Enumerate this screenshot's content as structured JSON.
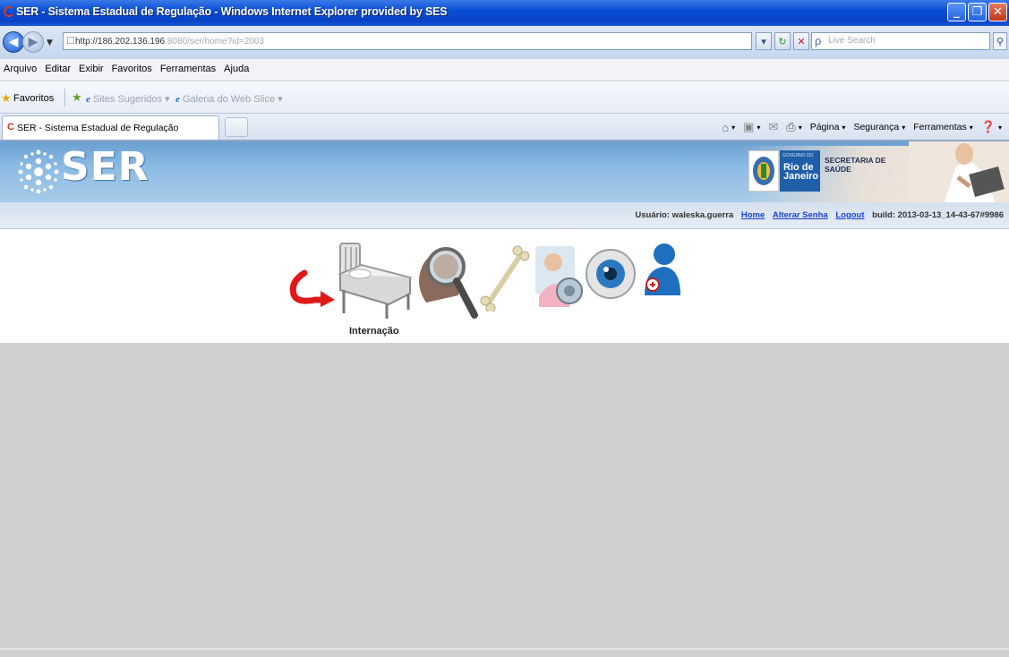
{
  "window": {
    "title": "SER - Sistema Estadual de Regulação - Windows Internet Explorer provided by SES",
    "buttons": [
      "_",
      "❐",
      "✕"
    ]
  },
  "address": {
    "url_main": "http://186.202.136.196",
    "url_rest": ":8080/ser/home?id=2003",
    "search_placeholder": "Live Search"
  },
  "menu": [
    "Arquivo",
    "Editar",
    "Exibir",
    "Favoritos",
    "Ferramentas",
    "Ajuda"
  ],
  "favorites": {
    "label": "Favoritos",
    "links": [
      "Sites Sugeridos ▾",
      "Galeria do Web Slice ▾"
    ]
  },
  "tab": {
    "title": "SER - Sistema Estadual de Regulação"
  },
  "command_bar": {
    "pagina": "Página",
    "seguranca": "Segurança",
    "ferramentas": "Ferramentas"
  },
  "header": {
    "logo": "SER",
    "rj_small": "GOVERNO DO",
    "rj_line1": "Rio de",
    "rj_line2": "Janeiro",
    "secretaria_line1": "SECRETARIA DE",
    "secretaria_line2": "SAÚDE"
  },
  "user": {
    "label": "Usuário: waleska.guerra",
    "home": "Home",
    "alterar_senha": "Alterar Senha",
    "logout": "Logout",
    "build": "build: 2013-03-13_14-43-67#9986"
  },
  "modules": {
    "active_label": "Internação"
  }
}
